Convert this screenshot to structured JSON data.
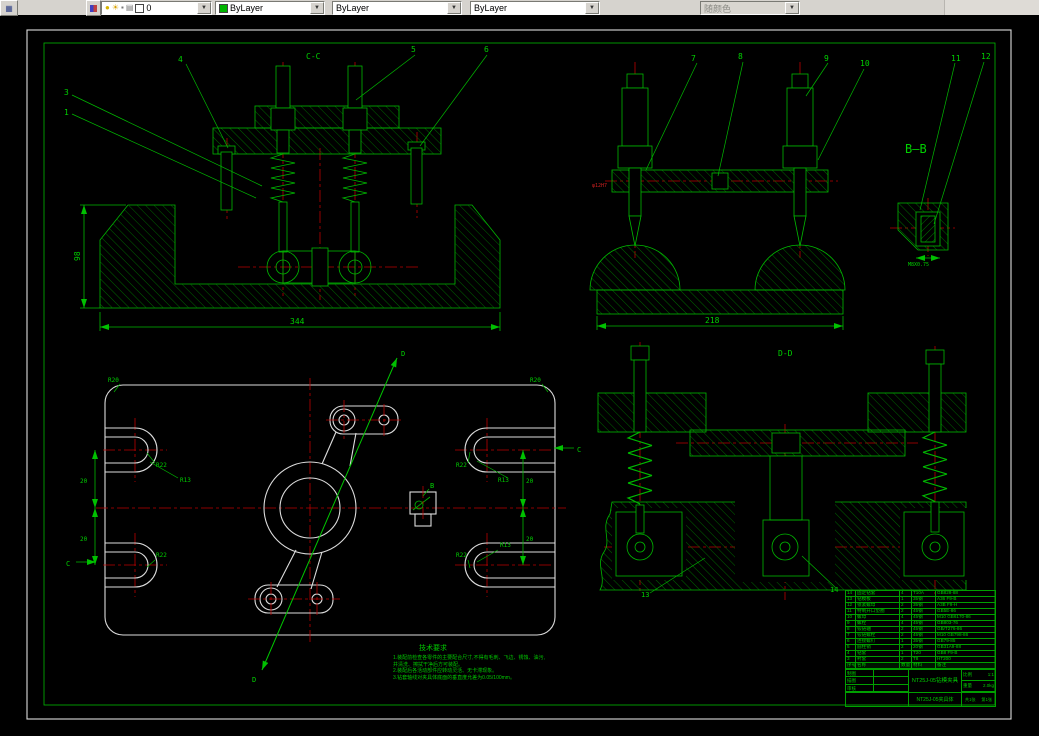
{
  "toolbar": {
    "layer_value": "0",
    "color_value": "ByLayer",
    "linetype_value": "ByLayer",
    "lineweight_value": "ByLayer",
    "plot_style_value": "随颜色"
  },
  "icons": {
    "dropdown": "▼",
    "bulb": "●",
    "sun": "☀",
    "lock": "▪",
    "plot": "▤",
    "swatch": "■",
    "app": "▦"
  },
  "drawing": {
    "view_labels": {
      "cc": "C-C",
      "bb": "B—B",
      "dd": "D-D"
    },
    "callouts": {
      "n1": "1",
      "n3": "3",
      "n4": "4",
      "n5": "5",
      "n6": "6",
      "n7": "7",
      "n8": "8",
      "n9": "9",
      "n10": "10",
      "n11": "11",
      "n12": "12",
      "n13": "13",
      "n14": "14"
    },
    "dims": {
      "v1_width": "344",
      "v1_height": "98",
      "v2_width": "218",
      "v2_hole": "φ12H7",
      "bb_thread": "M8X0.75",
      "r20_tl": "R20",
      "r20_tr": "R20",
      "r22_ul": "R22",
      "r22_ur": "R22",
      "r22_ll": "R22",
      "r22_lr": "R22",
      "r13_ul": "R13",
      "r13_ur": "R13",
      "r13_lr": "R13",
      "d20_l1": "20",
      "d20_l2": "20",
      "d20_r1": "20",
      "d20_r2": "20"
    },
    "section_letters": {
      "c_right": "C",
      "c_left": "C",
      "d_top": "D",
      "d_bottom": "D",
      "b_detail": "B"
    },
    "notes": {
      "title": "技术要求",
      "lines": [
        "1.装配前检查各零件的主要配合尺寸,不得有毛刺、飞边、锈蚀、油污,",
        "  并清洗、擦拭干净后方可装配。",
        "2.装配后各活动部件应转动灵活、无卡滞现象。",
        "3.钻套轴线对夹具体底面的垂直度允差为0.05/100mm。"
      ]
    }
  },
  "title_block": {
    "headers": [
      "序号",
      "名称",
      "数量",
      "材料",
      "备注"
    ],
    "rows": [
      [
        "14",
        "固定钻套",
        "4",
        "T10A",
        "GB828-88"
      ],
      [
        "13",
        "钻模板",
        "1",
        "35钢",
        "A36 F9-B"
      ],
      [
        "12",
        "锁紧螺母",
        "2",
        "35钢",
        "A3B F9-H"
      ],
      [
        "11",
        "特制开口垫圈",
        "2",
        "45钢",
        "GB5E-86"
      ],
      [
        "10",
        "螺母",
        "4",
        "45钢",
        "M10 GB6170-86"
      ],
      [
        "9",
        "螺栓",
        "4",
        "45钢",
        "GB803-76"
      ],
      [
        "8",
        "铰链轴",
        "2",
        "45钢",
        "GB/T276-86"
      ],
      [
        "7",
        "铰链螺栓",
        "2",
        "45钢",
        "M10 GB798-86"
      ],
      [
        "6",
        "连接螺钉",
        "1",
        "35钢",
        "GB79-85"
      ],
      [
        "5",
        "圆柱销",
        "2",
        "20钢",
        "GB31A9-88"
      ],
      [
        "4",
        "钻套",
        "1",
        "T20",
        "GB8 F9-B"
      ],
      [
        "3",
        "衬套",
        "2",
        "T8",
        "HT200"
      ]
    ],
    "fields": {
      "draw_label": "制图",
      "trace_label": "描图",
      "check_label": "审核",
      "drawing_code": "NT25J-05钻模夹具",
      "part_name": "NT25J-05夹具体",
      "scale_label": "比例",
      "scale": "1:1",
      "weight_label": "重量",
      "weight": "2.0kg",
      "sheet_total": "共1张",
      "sheet_no": "第1张"
    }
  }
}
